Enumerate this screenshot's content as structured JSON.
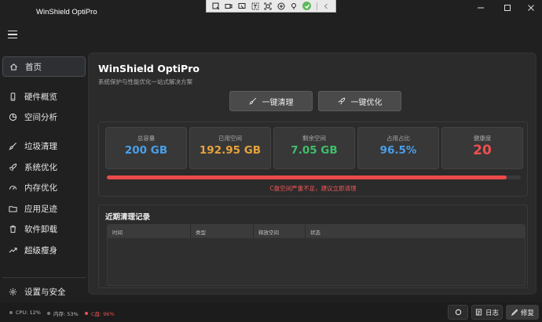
{
  "window": {
    "title": "WinShield OptiPro"
  },
  "nav": {
    "items": [
      {
        "label": "首页",
        "icon": "home-icon",
        "active": true
      },
      {
        "label": "硬件概览",
        "icon": "device-icon"
      },
      {
        "label": "空间分析",
        "icon": "pie-chart-icon"
      },
      {
        "label": "垃圾清理",
        "icon": "broom-icon"
      },
      {
        "label": "系统优化",
        "icon": "rocket-icon"
      },
      {
        "label": "内存优化",
        "icon": "gauge-icon"
      },
      {
        "label": "应用足迹",
        "icon": "folder-icon"
      },
      {
        "label": "软件卸载",
        "icon": "trash-icon"
      },
      {
        "label": "超级瘦身",
        "icon": "trend-icon"
      }
    ],
    "settings": {
      "label": "设置与安全",
      "icon": "gear-icon"
    }
  },
  "main": {
    "title": "WinShield OptiPro",
    "subtitle": "系统保护与性能优化一站式解决方案",
    "actions": [
      {
        "label": "一键清理",
        "icon": "broom-icon"
      },
      {
        "label": "一键优化",
        "icon": "rocket-icon"
      }
    ],
    "stats": [
      {
        "label": "总容量",
        "value": "200 GB",
        "color": "#4a9fe8"
      },
      {
        "label": "已用空间",
        "value": "192.95 GB",
        "color": "#e8a33a"
      },
      {
        "label": "剩余空间",
        "value": "7.05 GB",
        "color": "#3fbf6a"
      },
      {
        "label": "占用占比",
        "value": "96.5%",
        "color": "#4a9fe8"
      },
      {
        "label": "健康度",
        "value": "20",
        "color": "#ef4f4f"
      }
    ],
    "usage_fraction": 0.965,
    "usage_color": "#ec4a4a",
    "warning": "C盘空间严重不足，建议立即清理",
    "records": {
      "title": "近期清理记录",
      "columns": [
        "时间",
        "类型",
        "释放空间",
        "状态"
      ]
    }
  },
  "status_bar": {
    "cpu": "CPU: 12%",
    "cpu_color": "#7a7a7a",
    "mem": "内存: 53%",
    "mem_color": "#7a7a7a",
    "disk": "C盘: 96%",
    "disk_color": "#ef4f4f",
    "log_label": "日志",
    "repair_label": "修复"
  }
}
